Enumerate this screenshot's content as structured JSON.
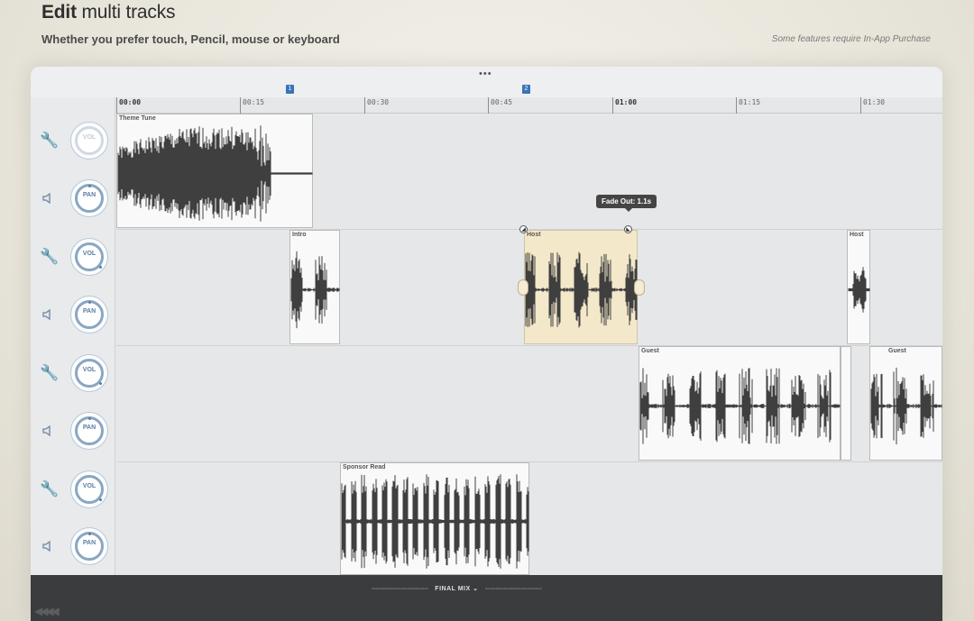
{
  "header": {
    "title_bold": "Edit",
    "title_rest": " multi tracks",
    "subtitle": "Whether you prefer touch, Pencil, mouse or keyboard",
    "note": "Some features require In-App Purchase"
  },
  "app": {
    "more_dots": "•••",
    "ruler": {
      "ticks": [
        "00:00",
        "00:15",
        "00:30",
        "00:45",
        "01:00",
        "01:15",
        "01:30"
      ],
      "markers": [
        "1",
        "2"
      ]
    },
    "tracks": [
      {
        "vol_label": "VOL",
        "pan_label": "PAN",
        "vol_enabled": false,
        "clips": [
          {
            "name": "Theme Tune",
            "selected": false
          }
        ]
      },
      {
        "vol_label": "VOL",
        "pan_label": "PAN",
        "vol_enabled": true,
        "clips": [
          {
            "name": "Intro",
            "selected": false
          },
          {
            "name": "Host",
            "selected": true
          },
          {
            "name": "Host",
            "selected": false
          }
        ]
      },
      {
        "vol_label": "VOL",
        "pan_label": "PAN",
        "vol_enabled": true,
        "clips": [
          {
            "name": "Guest",
            "selected": false
          },
          {
            "name": "",
            "selected": false
          },
          {
            "name": "Guest",
            "selected": false
          }
        ]
      },
      {
        "vol_label": "VOL",
        "pan_label": "PAN",
        "vol_enabled": true,
        "clips": [
          {
            "name": "Sponsor Read",
            "selected": false
          }
        ]
      }
    ],
    "tooltip": "Fade Out: 1.1s",
    "bottom": {
      "mix_label": "FINAL MIX",
      "dash_left": "---------------------------",
      "dash_right": "---------------------------",
      "rewind_glyph": "◀◀◀◀"
    }
  },
  "colors": {
    "accent": "#3a73b8",
    "knob_ring": "#8aa6c2",
    "selected_clip": "#f4e8cb",
    "bottom_bar": "#3b3c3d"
  },
  "icons": [
    "wrench-icon",
    "speaker-icon",
    "fade-handle-icon",
    "chevron-down-icon",
    "rewind-icon"
  ]
}
